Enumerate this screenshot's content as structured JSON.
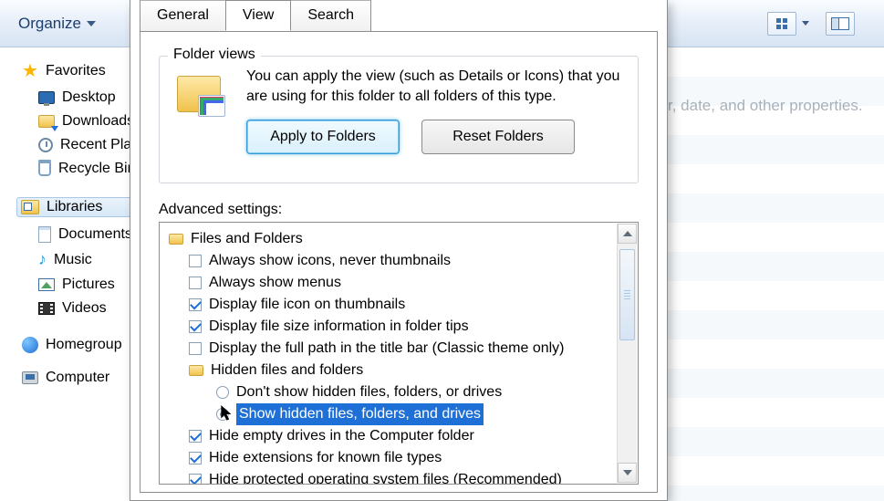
{
  "toolbar": {
    "organize": "Organize"
  },
  "hint": "r, date, and other properties.",
  "sidebar": {
    "favorites": "Favorites",
    "fav_items": [
      "Desktop",
      "Downloads",
      "Recent Places",
      "Recycle Bin"
    ],
    "libraries": "Libraries",
    "lib_items": [
      "Documents",
      "Music",
      "Pictures",
      "Videos"
    ],
    "homegroup": "Homegroup",
    "computer": "Computer"
  },
  "dialog": {
    "tabs": {
      "general": "General",
      "view": "View",
      "search": "Search"
    },
    "folder_views": {
      "legend": "Folder views",
      "text": "You can apply the view (such as Details or Icons) that you are using for this folder to all folders of this type.",
      "apply": "Apply to Folders",
      "reset": "Reset Folders"
    },
    "advanced_label": "Advanced settings:",
    "root": "Files and Folders",
    "items": [
      {
        "type": "check",
        "checked": false,
        "label": "Always show icons, never thumbnails"
      },
      {
        "type": "check",
        "checked": false,
        "label": "Always show menus"
      },
      {
        "type": "check",
        "checked": true,
        "label": "Display file icon on thumbnails"
      },
      {
        "type": "check",
        "checked": true,
        "label": "Display file size information in folder tips"
      },
      {
        "type": "check",
        "checked": false,
        "label": "Display the full path in the title bar (Classic theme only)"
      }
    ],
    "hidden_group": "Hidden files and folders",
    "hidden_opts": [
      {
        "label": "Don't show hidden files, folders, or drives",
        "selected": false
      },
      {
        "label": "Show hidden files, folders, and drives",
        "selected": true
      }
    ],
    "items2": [
      {
        "type": "check",
        "checked": true,
        "label": "Hide empty drives in the Computer folder"
      },
      {
        "type": "check",
        "checked": true,
        "label": "Hide extensions for known file types"
      },
      {
        "type": "check",
        "checked": true,
        "label": "Hide protected operating system files (Recommended)"
      }
    ]
  }
}
